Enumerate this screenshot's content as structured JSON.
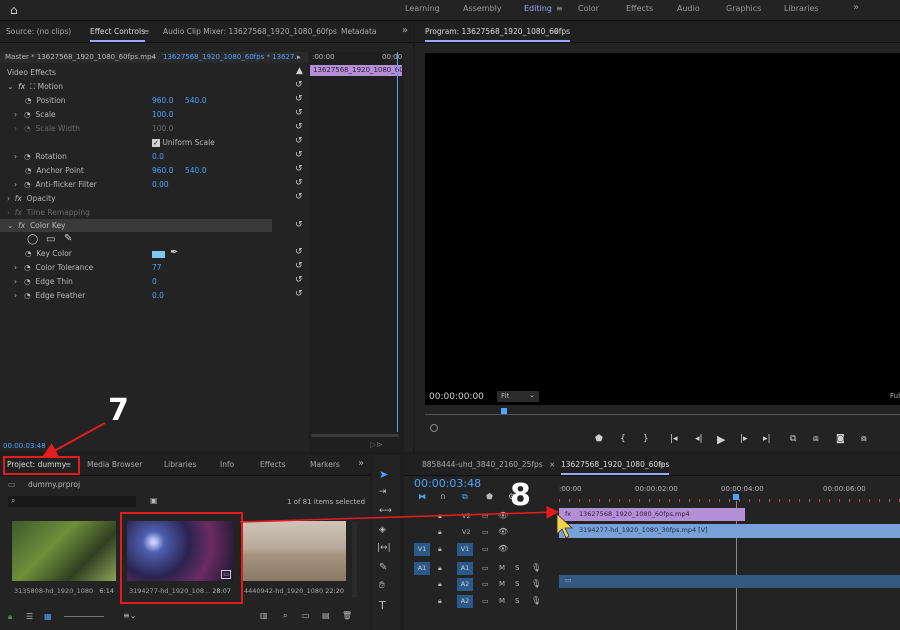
{
  "workspaces": [
    "Learning",
    "Assembly",
    "Editing",
    "Color",
    "Effects",
    "Audio",
    "Graphics",
    "Libraries"
  ],
  "active_workspace": "Editing",
  "top_tabs": {
    "source": "Source: (no clips)",
    "effect_controls": "Effect Controls",
    "audio_mixer": "Audio Clip Mixer: 13627568_1920_1080_60fps",
    "metadata": "Metadata"
  },
  "effect_controls": {
    "master": "Master * 13627568_1920_1080_60fps.mp4",
    "clip": "13627568_1920_1080_60fps * 13627...",
    "ruler_start": ":00:00",
    "ruler_end": "00:00",
    "clip_bar": "13627568_1920_1080_60fp",
    "section": "Video Effects",
    "motion": "Motion",
    "position": {
      "label": "Position",
      "x": "960.0",
      "y": "540.0"
    },
    "scale": {
      "label": "Scale",
      "value": "100.0"
    },
    "scale_width": {
      "label": "Scale Width",
      "value": "100.0"
    },
    "uniform_scale": "Uniform Scale",
    "rotation": {
      "label": "Rotation",
      "value": "0.0"
    },
    "anchor": {
      "label": "Anchor Point",
      "x": "960.0",
      "y": "540.0"
    },
    "antiflicker": {
      "label": "Anti-flicker Filter",
      "value": "0.00"
    },
    "opacity": "Opacity",
    "time_remap": "Time Remapping",
    "color_key": "Color Key",
    "key_color": "Key Color",
    "color_tolerance": {
      "label": "Color Tolerance",
      "value": "77"
    },
    "edge_thin": {
      "label": "Edge Thin",
      "value": "0"
    },
    "edge_feather": {
      "label": "Edge Feather",
      "value": "0.0"
    },
    "timecode": "00:00:03:48"
  },
  "program": {
    "title": "Program: 13627568_1920_1080_60fps",
    "timecode": "00:00:00:00",
    "fit": "Fit",
    "full": "Ful"
  },
  "project": {
    "tabs": [
      "Project: dummy",
      "Media Browser",
      "Libraries",
      "Info",
      "Effects",
      "Markers"
    ],
    "file": "dummy.prproj",
    "count": "1 of 81 items selected",
    "thumbs": [
      {
        "name": "3135808-hd_1920_1080",
        "dur": "6:14"
      },
      {
        "name": "3194277-hd_1920_108...",
        "dur": "28:07"
      },
      {
        "name": "4440942-hd_1920_1080",
        "dur": "22:20"
      }
    ]
  },
  "timeline": {
    "tabs": [
      "8858444-uhd_3840_2160_25fps",
      "13627568_1920_1080_60fps"
    ],
    "timecode": "00:00:03:48",
    "ruler": [
      ":00:00",
      "00:00:02:00",
      "00:00:04:00",
      "00:00:06:00"
    ],
    "tracks": {
      "v2": "V2",
      "v1": "V1",
      "a1": "A1",
      "a2": "A2"
    },
    "clip_v2": "13627568_1920_1080_60fps.mp4",
    "clip_v1": "3194277-hd_1920_1080_30fps.mp4 [V]"
  },
  "annotations": {
    "step7": "7",
    "step8": "8"
  },
  "colors": {
    "accent": "#9aa7ff",
    "blue_value": "#4da3ff",
    "clip_purple": "#b48fd6",
    "clip_blue": "#7aa0d8",
    "annotation_red": "#e11d1d"
  }
}
